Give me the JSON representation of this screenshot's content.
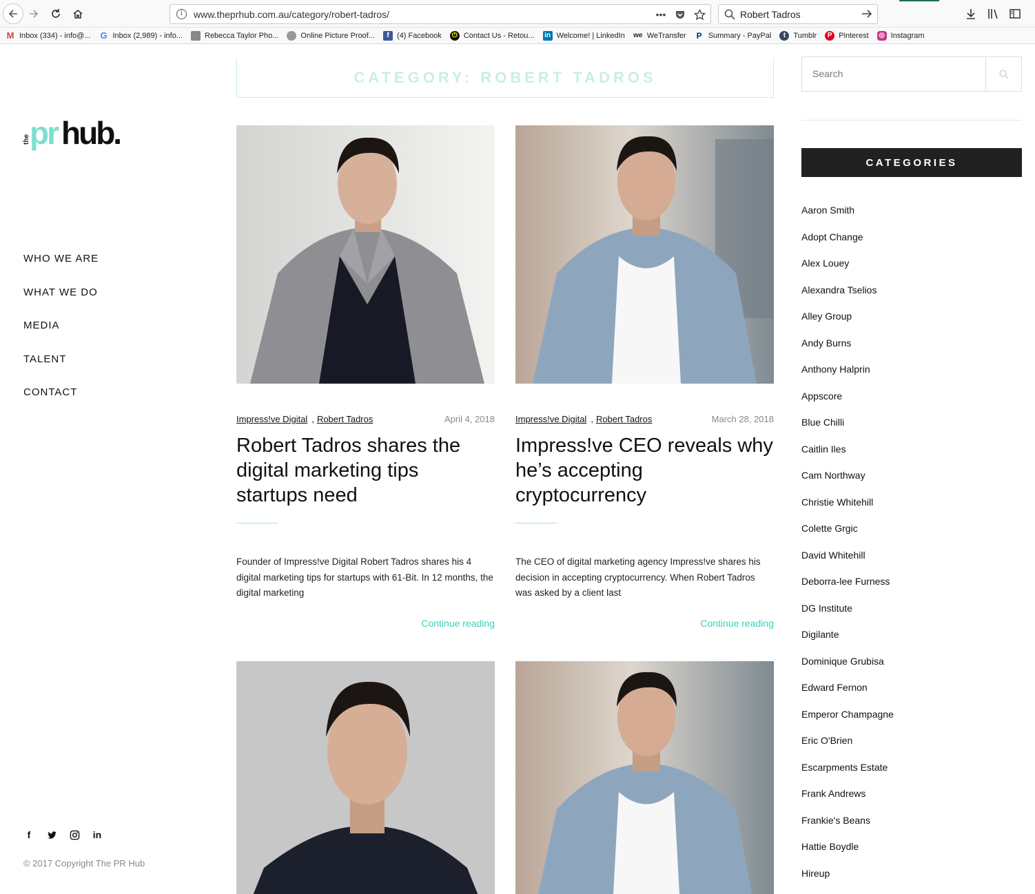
{
  "browser": {
    "url": "www.theprhub.com.au/category/robert-tadros/",
    "search_value": "Robert Tadros",
    "bookmarks": [
      {
        "label": "Inbox (334) - info@...",
        "icon": "gmail-icon",
        "color": "#d44638"
      },
      {
        "label": "Inbox (2,989) - info...",
        "icon": "google-icon",
        "color": "#4285f4"
      },
      {
        "label": "Rebecca Taylor Pho...",
        "icon": "photo-icon",
        "color": "#777777"
      },
      {
        "label": "Online Picture Proof...",
        "icon": "globe-icon",
        "color": "#888888"
      },
      {
        "label": "(4) Facebook",
        "icon": "facebook-icon",
        "color": "#3b5998"
      },
      {
        "label": "Contact Us - Retou...",
        "icon": "power-icon",
        "color": "#111111"
      },
      {
        "label": "Welcome! | LinkedIn",
        "icon": "linkedin-icon",
        "color": "#0077b5"
      },
      {
        "label": "WeTransfer",
        "icon": "wetransfer-icon",
        "color": "#222222"
      },
      {
        "label": "Summary - PayPal",
        "icon": "paypal-icon",
        "color": "#003087"
      },
      {
        "label": "Tumblr",
        "icon": "tumblr-icon",
        "color": "#36465d"
      },
      {
        "label": "Pinterest",
        "icon": "pinterest-icon",
        "color": "#e60023"
      },
      {
        "label": "Instagram",
        "icon": "instagram-icon",
        "color": "#c13584"
      }
    ]
  },
  "site": {
    "logo": {
      "the": "the",
      "pr": "pr",
      "hub": "hub."
    },
    "nav": [
      "WHO WE ARE",
      "WHAT WE DO",
      "MEDIA",
      "TALENT",
      "CONTACT"
    ],
    "copyright": "© 2017 Copyright The PR Hub",
    "accent": "#3ccfb6"
  },
  "main": {
    "category_title": "CATEGORY: ROBERT TADROS",
    "posts": [
      {
        "cat1": "Impress!ve Digital",
        "cat2": "Robert Tadros",
        "date": "April 4, 2018",
        "title": "Robert Tadros shares the digital marketing tips startups need",
        "excerpt": "Founder of Impress!ve Digital Robert Tadros shares his 4 digital marketing tips for startups with 61-Bit. In 12 months, the digital marketing",
        "more": "Continue reading"
      },
      {
        "cat1": "Impress!ve Digital",
        "cat2": "Robert Tadros",
        "date": "March 28, 2018",
        "title": "Impress!ve CEO reveals why he’s accepting cryptocurrency",
        "excerpt": "The CEO of digital marketing agency Impress!ve shares his decision in accepting cryptocurrency. When Robert Tadros was asked by a client last",
        "more": "Continue reading"
      }
    ]
  },
  "sidebar": {
    "search_placeholder": "Search",
    "categories_title": "CATEGORIES",
    "categories": [
      "Aaron Smith",
      "Adopt Change",
      "Alex Louey",
      "Alexandra Tselios",
      "Alley Group",
      "Andy Burns",
      "Anthony Halprin",
      "Appscore",
      "Blue Chilli",
      "Caitlin Iles",
      "Cam Northway",
      "Christie Whitehill",
      "Colette Grgic",
      "David Whitehill",
      "Deborra-lee Furness",
      "DG Institute",
      "Digilante",
      "Dominique Grubisa",
      "Edward Fernon",
      "Emperor Champagne",
      "Eric O'Brien",
      "Escarpments Estate",
      "Frank Andrews",
      "Frankie's Beans",
      "Hattie Boydle",
      "Hireup"
    ]
  }
}
